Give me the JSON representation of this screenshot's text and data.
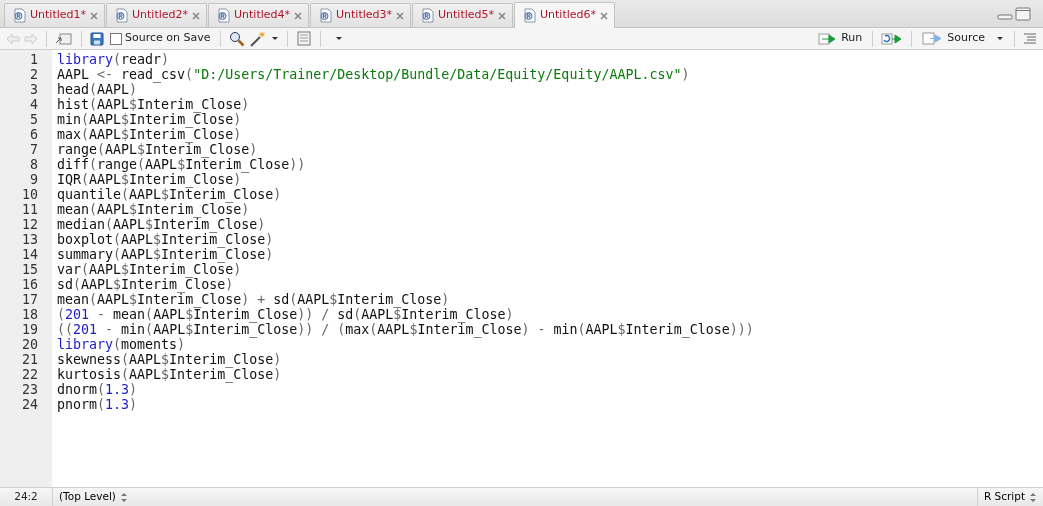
{
  "tabs": [
    {
      "label": "Untitled1*",
      "selected": false
    },
    {
      "label": "Untitled2*",
      "selected": false
    },
    {
      "label": "Untitled4*",
      "selected": false
    },
    {
      "label": "Untitled3*",
      "selected": false
    },
    {
      "label": "Untitled5*",
      "selected": false
    },
    {
      "label": "Untitled6*",
      "selected": true
    }
  ],
  "toolbar": {
    "source_on_save": {
      "label": "Source on Save",
      "checked": false
    },
    "run": {
      "label": "Run"
    },
    "source": {
      "label": "Source"
    }
  },
  "editor": {
    "lines": [
      {
        "number": "1",
        "tokens": [
          {
            "kind": "keyword",
            "text": "library"
          },
          {
            "kind": "punct",
            "text": "("
          },
          {
            "kind": "plain",
            "text": "readr"
          },
          {
            "kind": "punct",
            "text": ")"
          }
        ]
      },
      {
        "number": "2",
        "tokens": [
          {
            "kind": "plain",
            "text": "AAPL "
          },
          {
            "kind": "punct",
            "text": "<-"
          },
          {
            "kind": "plain",
            "text": " read_csv"
          },
          {
            "kind": "punct",
            "text": "("
          },
          {
            "kind": "string",
            "text": "\"D:/Users/Trainer/Desktop/Bundle/Data/Equity/Equity/AAPL.csv\""
          },
          {
            "kind": "punct",
            "text": ")"
          }
        ]
      },
      {
        "number": "3",
        "tokens": [
          {
            "kind": "plain",
            "text": "head"
          },
          {
            "kind": "punct",
            "text": "("
          },
          {
            "kind": "plain",
            "text": "AAPL"
          },
          {
            "kind": "punct",
            "text": ")"
          }
        ]
      },
      {
        "number": "4",
        "tokens": [
          {
            "kind": "plain",
            "text": "hist"
          },
          {
            "kind": "punct",
            "text": "("
          },
          {
            "kind": "plain",
            "text": "AAPL"
          },
          {
            "kind": "punct",
            "text": "$"
          },
          {
            "kind": "plain",
            "text": "Interim_Close"
          },
          {
            "kind": "punct",
            "text": ")"
          }
        ]
      },
      {
        "number": "5",
        "tokens": [
          {
            "kind": "plain",
            "text": "min"
          },
          {
            "kind": "punct",
            "text": "("
          },
          {
            "kind": "plain",
            "text": "AAPL"
          },
          {
            "kind": "punct",
            "text": "$"
          },
          {
            "kind": "plain",
            "text": "Interim_Close"
          },
          {
            "kind": "punct",
            "text": ")"
          }
        ]
      },
      {
        "number": "6",
        "tokens": [
          {
            "kind": "plain",
            "text": "max"
          },
          {
            "kind": "punct",
            "text": "("
          },
          {
            "kind": "plain",
            "text": "AAPL"
          },
          {
            "kind": "punct",
            "text": "$"
          },
          {
            "kind": "plain",
            "text": "Interim_Close"
          },
          {
            "kind": "punct",
            "text": ")"
          }
        ]
      },
      {
        "number": "7",
        "tokens": [
          {
            "kind": "plain",
            "text": "range"
          },
          {
            "kind": "punct",
            "text": "("
          },
          {
            "kind": "plain",
            "text": "AAPL"
          },
          {
            "kind": "punct",
            "text": "$"
          },
          {
            "kind": "plain",
            "text": "Interim_Close"
          },
          {
            "kind": "punct",
            "text": ")"
          }
        ]
      },
      {
        "number": "8",
        "tokens": [
          {
            "kind": "plain",
            "text": "diff"
          },
          {
            "kind": "punct",
            "text": "("
          },
          {
            "kind": "plain",
            "text": "range"
          },
          {
            "kind": "punct",
            "text": "("
          },
          {
            "kind": "plain",
            "text": "AAPL"
          },
          {
            "kind": "punct",
            "text": "$"
          },
          {
            "kind": "plain",
            "text": "Interim_Close"
          },
          {
            "kind": "punct",
            "text": "))"
          }
        ]
      },
      {
        "number": "9",
        "tokens": [
          {
            "kind": "plain",
            "text": "IQR"
          },
          {
            "kind": "punct",
            "text": "("
          },
          {
            "kind": "plain",
            "text": "AAPL"
          },
          {
            "kind": "punct",
            "text": "$"
          },
          {
            "kind": "plain",
            "text": "Interim_Close"
          },
          {
            "kind": "punct",
            "text": ")"
          }
        ]
      },
      {
        "number": "10",
        "tokens": [
          {
            "kind": "plain",
            "text": "quantile"
          },
          {
            "kind": "punct",
            "text": "("
          },
          {
            "kind": "plain",
            "text": "AAPL"
          },
          {
            "kind": "punct",
            "text": "$"
          },
          {
            "kind": "plain",
            "text": "Interim_Close"
          },
          {
            "kind": "punct",
            "text": ")"
          }
        ]
      },
      {
        "number": "11",
        "tokens": [
          {
            "kind": "plain",
            "text": "mean"
          },
          {
            "kind": "punct",
            "text": "("
          },
          {
            "kind": "plain",
            "text": "AAPL"
          },
          {
            "kind": "punct",
            "text": "$"
          },
          {
            "kind": "plain",
            "text": "Interim_Close"
          },
          {
            "kind": "punct",
            "text": ")"
          }
        ]
      },
      {
        "number": "12",
        "tokens": [
          {
            "kind": "plain",
            "text": "median"
          },
          {
            "kind": "punct",
            "text": "("
          },
          {
            "kind": "plain",
            "text": "AAPL"
          },
          {
            "kind": "punct",
            "text": "$"
          },
          {
            "kind": "plain",
            "text": "Interim_Close"
          },
          {
            "kind": "punct",
            "text": ")"
          }
        ]
      },
      {
        "number": "13",
        "tokens": [
          {
            "kind": "plain",
            "text": "boxplot"
          },
          {
            "kind": "punct",
            "text": "("
          },
          {
            "kind": "plain",
            "text": "AAPL"
          },
          {
            "kind": "punct",
            "text": "$"
          },
          {
            "kind": "plain",
            "text": "Interim_Close"
          },
          {
            "kind": "punct",
            "text": ")"
          }
        ]
      },
      {
        "number": "14",
        "tokens": [
          {
            "kind": "plain",
            "text": "summary"
          },
          {
            "kind": "punct",
            "text": "("
          },
          {
            "kind": "plain",
            "text": "AAPL"
          },
          {
            "kind": "punct",
            "text": "$"
          },
          {
            "kind": "plain",
            "text": "Interim_Close"
          },
          {
            "kind": "punct",
            "text": ")"
          }
        ]
      },
      {
        "number": "15",
        "tokens": [
          {
            "kind": "plain",
            "text": "var"
          },
          {
            "kind": "punct",
            "text": "("
          },
          {
            "kind": "plain",
            "text": "AAPL"
          },
          {
            "kind": "punct",
            "text": "$"
          },
          {
            "kind": "plain",
            "text": "Interim_Close"
          },
          {
            "kind": "punct",
            "text": ")"
          }
        ]
      },
      {
        "number": "16",
        "tokens": [
          {
            "kind": "plain",
            "text": "sd"
          },
          {
            "kind": "punct",
            "text": "("
          },
          {
            "kind": "plain",
            "text": "AAPL"
          },
          {
            "kind": "punct",
            "text": "$"
          },
          {
            "kind": "plain",
            "text": "Interim_Close"
          },
          {
            "kind": "punct",
            "text": ")"
          }
        ]
      },
      {
        "number": "17",
        "tokens": [
          {
            "kind": "plain",
            "text": "mean"
          },
          {
            "kind": "punct",
            "text": "("
          },
          {
            "kind": "plain",
            "text": "AAPL"
          },
          {
            "kind": "punct",
            "text": "$"
          },
          {
            "kind": "plain",
            "text": "Interim_Close"
          },
          {
            "kind": "punct",
            "text": ") + "
          },
          {
            "kind": "plain",
            "text": "sd"
          },
          {
            "kind": "punct",
            "text": "("
          },
          {
            "kind": "plain",
            "text": "AAPL"
          },
          {
            "kind": "punct",
            "text": "$"
          },
          {
            "kind": "plain",
            "text": "Interim_Close"
          },
          {
            "kind": "punct",
            "text": ")"
          }
        ]
      },
      {
        "number": "18",
        "tokens": [
          {
            "kind": "punct",
            "text": "("
          },
          {
            "kind": "number",
            "text": "201"
          },
          {
            "kind": "punct",
            "text": " - "
          },
          {
            "kind": "plain",
            "text": "mean"
          },
          {
            "kind": "punct",
            "text": "("
          },
          {
            "kind": "plain",
            "text": "AAPL"
          },
          {
            "kind": "punct",
            "text": "$"
          },
          {
            "kind": "plain",
            "text": "Interim_Close"
          },
          {
            "kind": "punct",
            "text": ")) / "
          },
          {
            "kind": "plain",
            "text": "sd"
          },
          {
            "kind": "punct",
            "text": "("
          },
          {
            "kind": "plain",
            "text": "AAPL"
          },
          {
            "kind": "punct",
            "text": "$"
          },
          {
            "kind": "plain",
            "text": "Interim_Close"
          },
          {
            "kind": "punct",
            "text": ")"
          }
        ]
      },
      {
        "number": "19",
        "tokens": [
          {
            "kind": "punct",
            "text": "(("
          },
          {
            "kind": "number",
            "text": "201"
          },
          {
            "kind": "punct",
            "text": " - "
          },
          {
            "kind": "plain",
            "text": "min"
          },
          {
            "kind": "punct",
            "text": "("
          },
          {
            "kind": "plain",
            "text": "AAPL"
          },
          {
            "kind": "punct",
            "text": "$"
          },
          {
            "kind": "plain",
            "text": "Interim_Close"
          },
          {
            "kind": "punct",
            "text": ")) / ("
          },
          {
            "kind": "plain",
            "text": "max"
          },
          {
            "kind": "punct",
            "text": "("
          },
          {
            "kind": "plain",
            "text": "AAPL"
          },
          {
            "kind": "punct",
            "text": "$"
          },
          {
            "kind": "plain",
            "text": "Interim_Close"
          },
          {
            "kind": "punct",
            "text": ") - "
          },
          {
            "kind": "plain",
            "text": "min"
          },
          {
            "kind": "punct",
            "text": "("
          },
          {
            "kind": "plain",
            "text": "AAPL"
          },
          {
            "kind": "punct",
            "text": "$"
          },
          {
            "kind": "plain",
            "text": "Interim_Close"
          },
          {
            "kind": "punct",
            "text": ")))"
          }
        ]
      },
      {
        "number": "20",
        "tokens": [
          {
            "kind": "keyword",
            "text": "library"
          },
          {
            "kind": "punct",
            "text": "("
          },
          {
            "kind": "plain",
            "text": "moments"
          },
          {
            "kind": "punct",
            "text": ")"
          }
        ]
      },
      {
        "number": "21",
        "tokens": [
          {
            "kind": "plain",
            "text": "skewness"
          },
          {
            "kind": "punct",
            "text": "("
          },
          {
            "kind": "plain",
            "text": "AAPL"
          },
          {
            "kind": "punct",
            "text": "$"
          },
          {
            "kind": "plain",
            "text": "Interim_Close"
          },
          {
            "kind": "punct",
            "text": ")"
          }
        ]
      },
      {
        "number": "22",
        "tokens": [
          {
            "kind": "plain",
            "text": "kurtosis"
          },
          {
            "kind": "punct",
            "text": "("
          },
          {
            "kind": "plain",
            "text": "AAPL"
          },
          {
            "kind": "punct",
            "text": "$"
          },
          {
            "kind": "plain",
            "text": "Interim_Close"
          },
          {
            "kind": "punct",
            "text": ")"
          }
        ]
      },
      {
        "number": "23",
        "tokens": [
          {
            "kind": "plain",
            "text": "dnorm"
          },
          {
            "kind": "punct",
            "text": "("
          },
          {
            "kind": "number",
            "text": "1.3"
          },
          {
            "kind": "punct",
            "text": ")"
          }
        ]
      },
      {
        "number": "24",
        "tokens": [
          {
            "kind": "plain",
            "text": "pnorm"
          },
          {
            "kind": "punct",
            "text": "("
          },
          {
            "kind": "number",
            "text": "1.3"
          },
          {
            "kind": "punct",
            "text": ")"
          }
        ]
      }
    ]
  },
  "status_bar": {
    "cursor": "24:2",
    "scope": "(Top Level)",
    "file_type": "R Script"
  }
}
